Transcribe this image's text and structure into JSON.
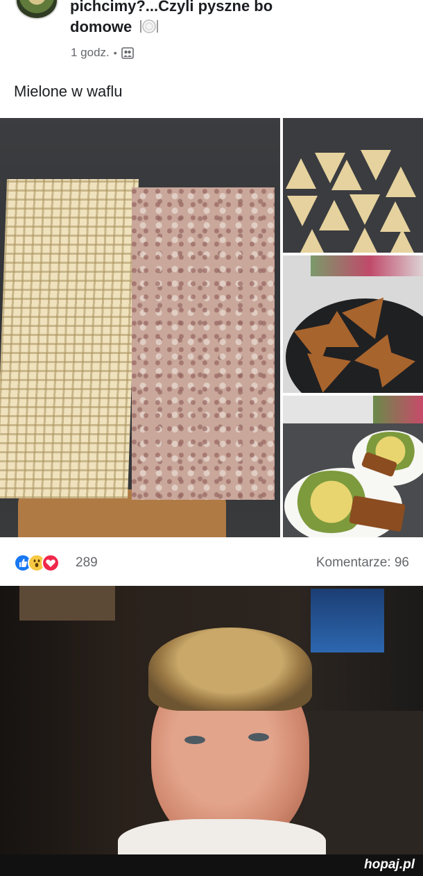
{
  "post": {
    "group_title_line1": "pichcimy?...Czyli pyszne bo",
    "group_title_line2": "domowe",
    "time": "1 godz.",
    "separator": "•",
    "audience_icon": "group-audience-icon",
    "text": "Mielone w waflu"
  },
  "photos": [
    {
      "name": "wafer-with-minced-meat-photo"
    },
    {
      "name": "wafer-triangles-photo"
    },
    {
      "name": "frying-pan-photo"
    },
    {
      "name": "served-plates-photo"
    }
  ],
  "reactions": {
    "icons": [
      "like-icon",
      "wow-icon",
      "love-icon"
    ],
    "count": "289",
    "comments": "Komentarze: 96"
  },
  "reaction_image": {
    "name": "chef-reaction-photo"
  },
  "watermark": {
    "brand": "hopaj",
    "tld": ".pl"
  },
  "colors": {
    "like": "#1877f2",
    "wow": "#f7c843",
    "love": "#f0284a",
    "secondary_text": "#65676b"
  }
}
